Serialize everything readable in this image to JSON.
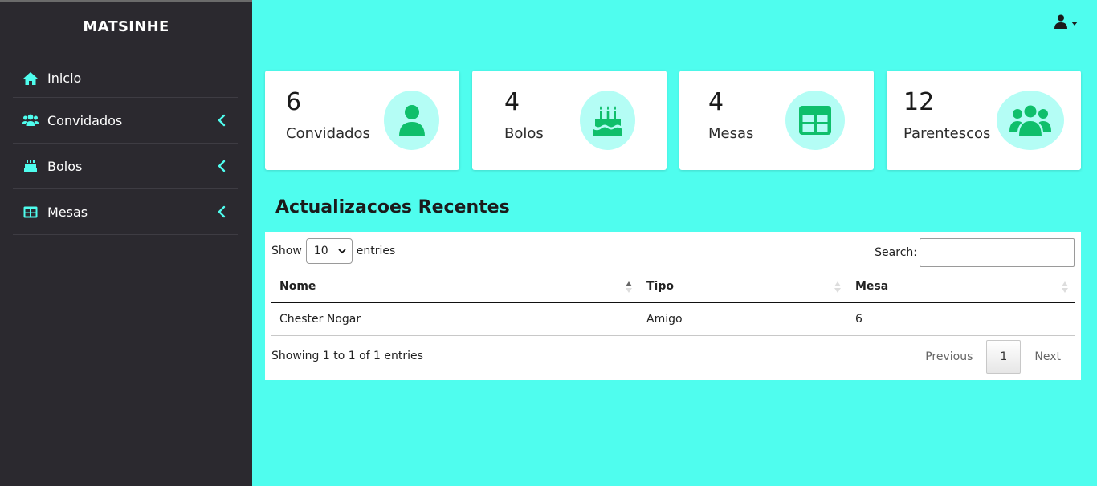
{
  "brand": "MATSINHE",
  "sidebar": {
    "items": [
      {
        "label": "Inicio",
        "icon": "home-icon"
      },
      {
        "label": "Convidados",
        "icon": "users-icon"
      },
      {
        "label": "Bolos",
        "icon": "cake-icon"
      },
      {
        "label": "Mesas",
        "icon": "table-icon"
      }
    ]
  },
  "stats": [
    {
      "value": "6",
      "label": "Convidados",
      "icon": "user-icon"
    },
    {
      "value": "4",
      "label": "Bolos",
      "icon": "birthday-cake-icon"
    },
    {
      "value": "4",
      "label": "Mesas",
      "icon": "table-icon"
    },
    {
      "value": "12",
      "label": "Parentescos",
      "icon": "users-icon"
    }
  ],
  "section_title": "Actualizacoes Recentes",
  "table": {
    "show_label": "Show",
    "entries_label": "entries",
    "page_length": "10",
    "search_label": "Search:",
    "search_value": "",
    "columns": [
      "Nome",
      "Tipo",
      "Mesa"
    ],
    "rows": [
      [
        "Chester Nogar",
        "Amigo",
        "6"
      ]
    ],
    "info": "Showing 1 to 1 of 1 entries",
    "pagination": {
      "previous": "Previous",
      "current": "1",
      "next": "Next"
    }
  },
  "colors": {
    "background": "#4ffdee",
    "sidebar": "#2b292f",
    "accent_icon": "#4ffdee",
    "stat_icon": "#0fbf6b",
    "stat_circle": "#b4fdf5"
  }
}
